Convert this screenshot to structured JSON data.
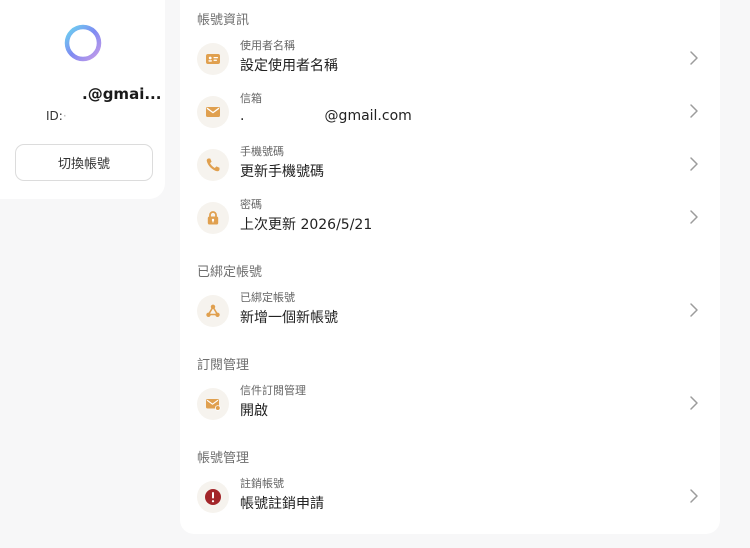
{
  "profile": {
    "email_title": ".@gmai...",
    "id_label": "ID:",
    "id_value": "·",
    "switch_label": "切換帳號"
  },
  "sections": [
    {
      "title": "帳號資訊",
      "rows": [
        {
          "icon": "id-card-icon",
          "label": "使用者名稱",
          "value": "設定使用者名稱"
        },
        {
          "icon": "envelope-icon",
          "label": "信箱",
          "value": ".                  @gmail.com"
        },
        {
          "icon": "phone-icon",
          "label": "手機號碼",
          "value": "更新手機號碼"
        },
        {
          "icon": "lock-icon",
          "label": "密碼",
          "value": "上次更新 2026/5/21"
        }
      ]
    },
    {
      "title": "已綁定帳號",
      "rows": [
        {
          "icon": "linked-accounts-icon",
          "label": "已綁定帳號",
          "value": "新增一個新帳號"
        }
      ]
    },
    {
      "title": "訂閱管理",
      "rows": [
        {
          "icon": "mail-subscription-icon",
          "label": "信件訂閱管理",
          "value": "開啟"
        }
      ]
    },
    {
      "title": "帳號管理",
      "rows": [
        {
          "icon": "alert-icon",
          "label": "註銷帳號",
          "value": "帳號註銷申請"
        }
      ]
    }
  ],
  "colors": {
    "icon_accent": "#e0a04f",
    "alert": "#a3262a",
    "icon_bg": "#f6f3ee"
  }
}
